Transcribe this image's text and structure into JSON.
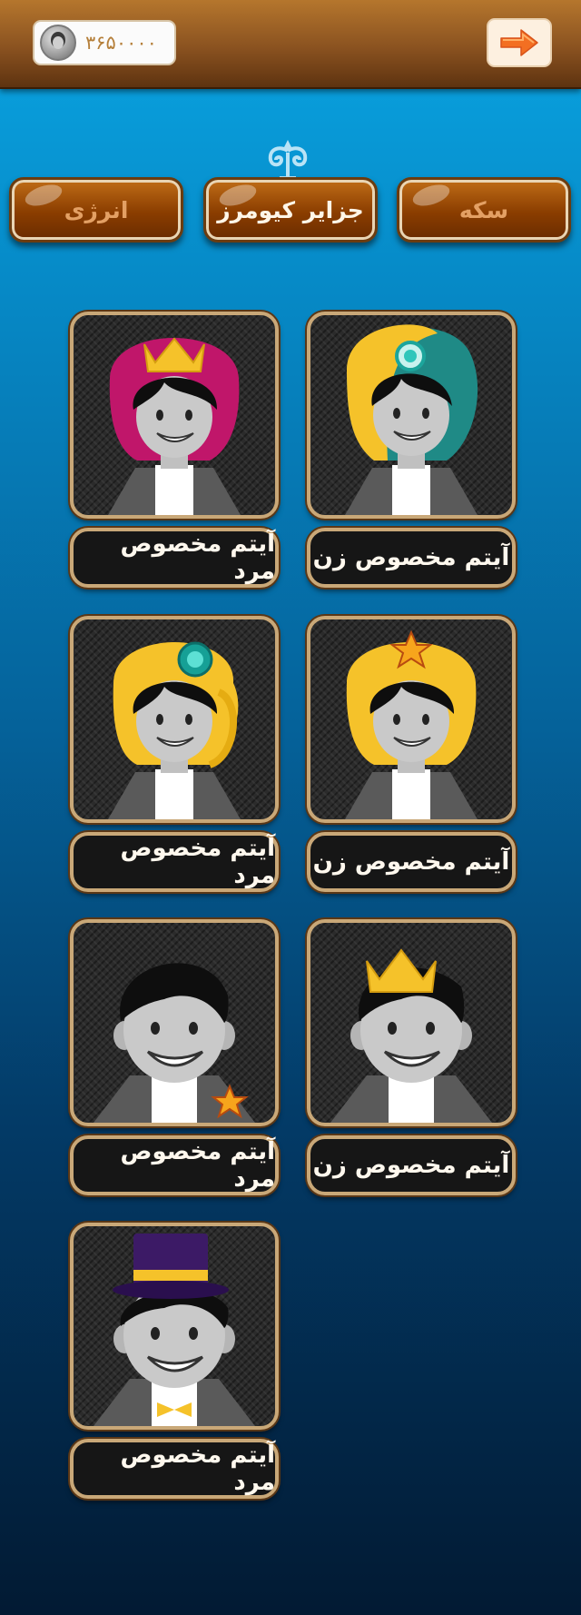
{
  "header": {
    "coin_balance": "۳۶۵۰۰۰۰",
    "back_icon": "arrow-right-icon"
  },
  "tabs": [
    {
      "label": "انرژی",
      "active": false
    },
    {
      "label": "جزایر کیومرز",
      "active": true
    },
    {
      "label": "سکه",
      "active": false
    }
  ],
  "items": [
    {
      "label": "آیتم مخصوص زن",
      "accessory": "teal-gold-scarf-gem"
    },
    {
      "label": "آیتم مخصوص مرد",
      "accessory": "magenta-scarf-crown"
    },
    {
      "label": "آیتم مخصوص زن",
      "accessory": "gold-scarf-star"
    },
    {
      "label": "آیتم مخصوص مرد",
      "accessory": "gold-scarf-gem"
    },
    {
      "label": "آیتم مخصوص زن",
      "accessory": "crown"
    },
    {
      "label": "آیتم مخصوص مرد",
      "accessory": "star-pin"
    },
    {
      "label": "آیتم مخصوص مرد",
      "accessory": "top-hat-bowtie"
    }
  ],
  "colors": {
    "accent_gold": "#f5c22a",
    "wood_brown": "#8a3d00",
    "background_blue": "#0689c6"
  }
}
